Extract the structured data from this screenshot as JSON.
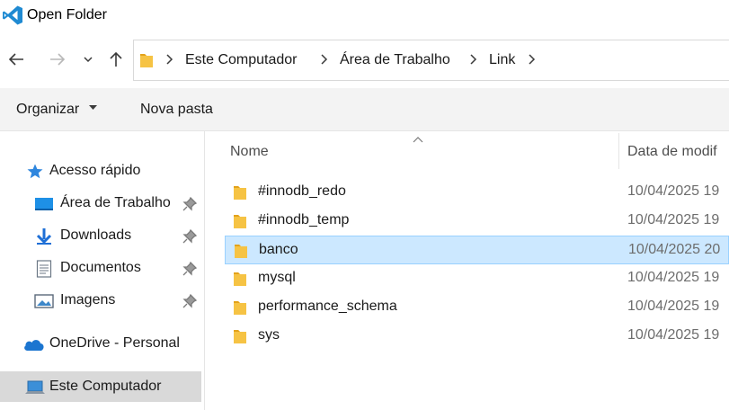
{
  "window": {
    "title": "Open Folder",
    "app_icon": "vscode-icon"
  },
  "nav": {
    "icons": [
      "back-arrow-icon",
      "forward-arrow-icon",
      "chevron-down-icon",
      "up-arrow-icon"
    ]
  },
  "address": {
    "crumbs": [
      "Este Computador",
      "Área de Trabalho",
      "Link"
    ]
  },
  "toolbar": {
    "organize_label": "Organizar",
    "new_folder_label": "Nova pasta"
  },
  "sidebar": {
    "quick_access": "Acesso rápido",
    "items": [
      {
        "label": "Área de Trabalho",
        "icon": "desktop-icon",
        "pinned": true
      },
      {
        "label": "Downloads",
        "icon": "download-arrow-icon",
        "pinned": true
      },
      {
        "label": "Documentos",
        "icon": "document-icon",
        "pinned": true
      },
      {
        "label": "Imagens",
        "icon": "image-icon",
        "pinned": true
      }
    ],
    "onedrive": "OneDrive - Personal",
    "this_pc": "Este Computador"
  },
  "columns": {
    "name": "Nome",
    "date": "Data de modif"
  },
  "files": [
    {
      "name": "#innodb_redo",
      "date": "10/04/2025 19"
    },
    {
      "name": "#innodb_temp",
      "date": "10/04/2025 19"
    },
    {
      "name": "banco",
      "date": "10/04/2025 20",
      "selected": true
    },
    {
      "name": "mysql",
      "date": "10/04/2025 19"
    },
    {
      "name": "performance_schema",
      "date": "10/04/2025 19"
    },
    {
      "name": "sys",
      "date": "10/04/2025 19"
    }
  ],
  "colors": {
    "accent": "#0078d4",
    "folder": "#f6c344",
    "selection": "#cce8ff",
    "selection_border": "#99d1ff"
  }
}
